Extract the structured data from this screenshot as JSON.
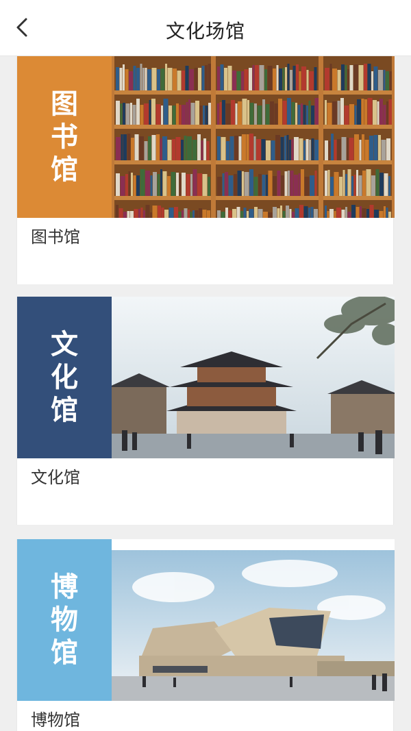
{
  "nav": {
    "title": "文化场馆",
    "back_icon": "chevron-left-icon"
  },
  "venues": [
    {
      "name": "图书馆",
      "tag_chars": [
        "图",
        "书",
        "馆"
      ],
      "tag_color": "#dc8a35",
      "photo": "bookshelves-photo"
    },
    {
      "name": "文化馆",
      "tag_chars": [
        "文",
        "化",
        "馆"
      ],
      "tag_color": "#334f7a",
      "photo": "traditional-building-photo"
    },
    {
      "name": "博物馆",
      "tag_chars": [
        "博",
        "物",
        "馆"
      ],
      "tag_color": "#6fb6de",
      "photo": "modern-museum-photo"
    }
  ]
}
